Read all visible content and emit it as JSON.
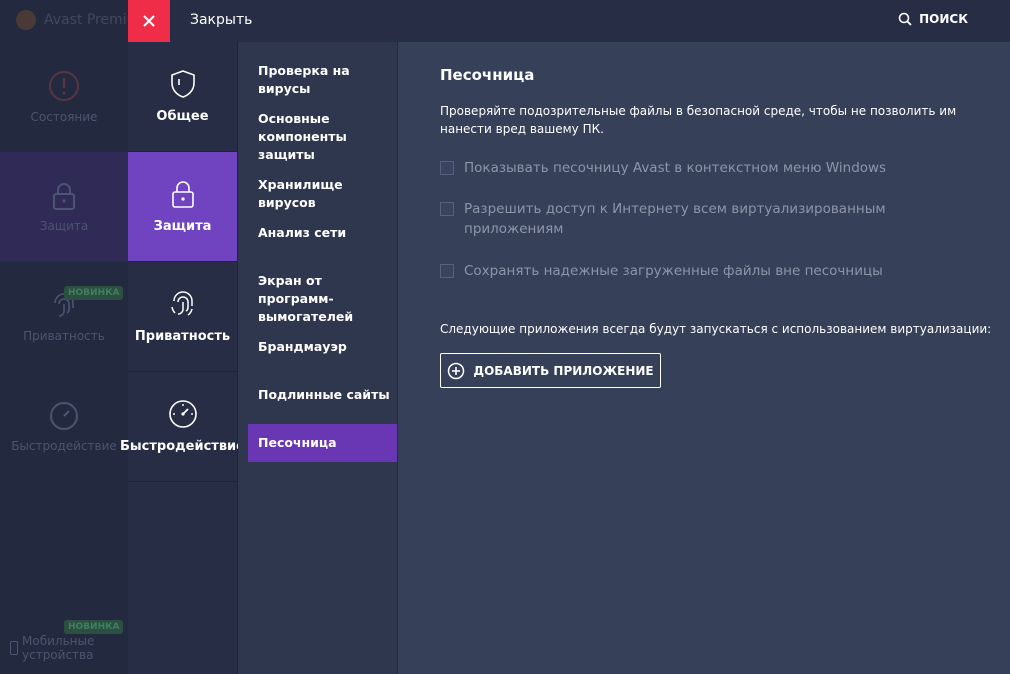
{
  "colors": {
    "close_red": "#f02d48",
    "accent_purple": "#7043c0"
  },
  "bg_app": {
    "title": "Avast Premiu",
    "items": [
      {
        "label": "Состояние",
        "icon": "alert-circle-icon"
      },
      {
        "label": "Защита",
        "icon": "lock-icon"
      },
      {
        "label": "Приватность",
        "icon": "fingerprint-icon",
        "badge": "НОВИНКА"
      },
      {
        "label": "Быстродействие",
        "icon": "speedometer-icon"
      }
    ],
    "mobile": {
      "line1": "Мобильные",
      "line2": "устройства",
      "badge": "НОВИНКА"
    }
  },
  "topbar": {
    "close_label": "Закрыть",
    "search_label": "ПОИСК"
  },
  "categories": [
    {
      "label": "Общее",
      "icon": "shield-icon"
    },
    {
      "label": "Защита",
      "icon": "lock-icon",
      "active": true
    },
    {
      "label": "Приватность",
      "icon": "fingerprint-icon"
    },
    {
      "label": "Быстродействие",
      "icon": "speedometer-icon"
    }
  ],
  "subitems": [
    "Проверка на вирусы",
    "Основные компоненты защиты",
    "Хранилище вирусов",
    "Анализ сети",
    "Экран от программ-вымогателей",
    "Брандмауэр",
    "Подлинные сайты",
    "Песочница"
  ],
  "content": {
    "title": "Песочница",
    "description": "Проверяйте подозрительные файлы в безопасной среде, чтобы не позволить им нанести вред вашему ПК.",
    "options": [
      {
        "label": "Показывать песочницу Avast в контекстном меню Windows",
        "checked": false
      },
      {
        "label": "Разрешить доступ к Интернету всем виртуализированным приложениям",
        "checked": false
      },
      {
        "label": "Сохранять надежные загруженные файлы вне песочницы",
        "checked": false
      }
    ],
    "note": "Следующие приложения всегда будут запускаться с использованием виртуализации:",
    "add_button": "ДОБАВИТЬ ПРИЛОЖЕНИЕ"
  }
}
